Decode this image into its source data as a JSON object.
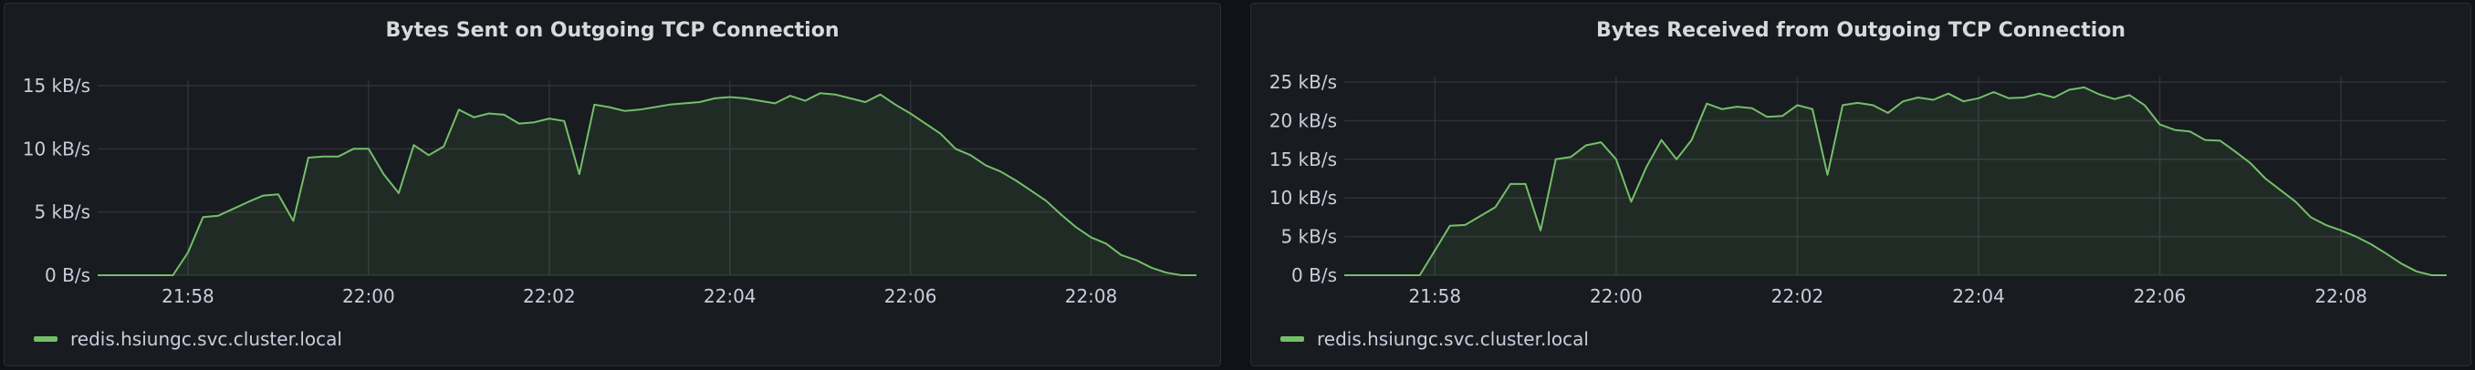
{
  "colors": {
    "series": "#73bf69",
    "grid": "#2f3237",
    "text": "#ccccdc"
  },
  "panels": [
    {
      "title": "Bytes Sent on Outgoing TCP Connection",
      "legend": "redis.hsiungc.svc.cluster.local"
    },
    {
      "title": "Bytes Received from Outgoing TCP Connection",
      "legend": "redis.hsiungc.svc.cluster.local"
    }
  ],
  "chart_data": [
    {
      "type": "area",
      "title": "Bytes Sent on Outgoing TCP Connection",
      "unit": "kB/s",
      "ylim": [
        0,
        15
      ],
      "yticks": [
        0,
        5,
        10,
        15
      ],
      "ytick_labels": [
        "0 B/s",
        "5 kB/s",
        "10 kB/s",
        "15 kB/s"
      ],
      "xlim": [
        "21:57:00",
        "21:09:10"
      ],
      "xticks": [
        "21:58",
        "22:00",
        "22:02",
        "22:04",
        "22:06",
        "22:08"
      ],
      "grid": true,
      "legend_position": "bottom-left",
      "series": [
        {
          "name": "redis.hsiungc.svc.cluster.local",
          "x": [
            "21:57:00",
            "21:57:50",
            "21:58:00",
            "21:58:10",
            "21:58:20",
            "21:58:40",
            "21:58:50",
            "21:59:00",
            "21:59:10",
            "21:59:20",
            "21:59:30",
            "21:59:40",
            "21:59:50",
            "22:00:00",
            "22:00:10",
            "22:00:20",
            "22:00:30",
            "22:00:40",
            "22:00:50",
            "22:01:00",
            "22:01:10",
            "22:01:20",
            "22:01:30",
            "22:01:40",
            "22:01:50",
            "22:02:00",
            "22:02:10",
            "22:02:20",
            "22:02:30",
            "22:02:40",
            "22:02:50",
            "22:03:00",
            "22:03:10",
            "22:03:20",
            "22:03:30",
            "22:03:40",
            "22:03:50",
            "22:04:00",
            "22:04:10",
            "22:04:20",
            "22:04:30",
            "22:04:40",
            "22:04:50",
            "22:05:00",
            "22:05:10",
            "22:05:20",
            "22:05:30",
            "22:05:40",
            "22:05:50",
            "22:06:00",
            "22:06:10",
            "22:06:20",
            "22:06:30",
            "22:06:40",
            "22:06:50",
            "22:07:00",
            "22:07:10",
            "22:07:20",
            "22:07:30",
            "22:07:40",
            "22:07:50",
            "22:08:00",
            "22:08:10",
            "22:08:20",
            "22:08:30",
            "22:08:40",
            "22:08:50",
            "22:09:00",
            "22:09:10"
          ],
          "values": [
            0,
            0,
            1.8,
            4.6,
            4.7,
            5.8,
            6.3,
            6.4,
            4.3,
            9.3,
            9.4,
            9.4,
            10.0,
            10.0,
            8.0,
            6.5,
            10.3,
            9.5,
            10.2,
            13.1,
            12.5,
            12.8,
            12.7,
            12.0,
            12.1,
            12.4,
            12.2,
            8.0,
            13.5,
            13.3,
            13.0,
            13.1,
            13.3,
            13.5,
            13.6,
            13.7,
            14.0,
            14.1,
            14.0,
            13.8,
            13.6,
            14.2,
            13.8,
            14.4,
            14.3,
            14.0,
            13.7,
            14.3,
            13.5,
            12.8,
            12.0,
            11.2,
            10.0,
            9.5,
            8.7,
            8.2,
            7.5,
            6.7,
            5.9,
            4.8,
            3.8,
            3.0,
            2.5,
            1.6,
            1.2,
            0.6,
            0.2,
            0,
            0
          ]
        }
      ]
    },
    {
      "type": "area",
      "title": "Bytes Received from Outgoing TCP Connection",
      "unit": "kB/s",
      "ylim": [
        0,
        25
      ],
      "yticks": [
        0,
        5,
        10,
        15,
        20,
        25
      ],
      "ytick_labels": [
        "0 B/s",
        "5 kB/s",
        "10 kB/s",
        "15 kB/s",
        "20 kB/s",
        "25 kB/s"
      ],
      "xlim": [
        "21:57:00",
        "22:09:10"
      ],
      "xticks": [
        "21:58",
        "22:00",
        "22:02",
        "22:04",
        "22:06",
        "22:08"
      ],
      "grid": true,
      "legend_position": "bottom-left",
      "series": [
        {
          "name": "redis.hsiungc.svc.cluster.local",
          "x": [
            "21:57:00",
            "21:57:50",
            "21:58:00",
            "21:58:10",
            "21:58:20",
            "21:58:40",
            "21:58:50",
            "21:59:00",
            "21:59:10",
            "21:59:20",
            "21:59:30",
            "21:59:40",
            "21:59:50",
            "22:00:00",
            "22:00:10",
            "22:00:20",
            "22:00:30",
            "22:00:40",
            "22:00:50",
            "22:01:00",
            "22:01:10",
            "22:01:20",
            "22:01:30",
            "22:01:40",
            "22:01:50",
            "22:02:00",
            "22:02:10",
            "22:02:20",
            "22:02:30",
            "22:02:40",
            "22:02:50",
            "22:03:00",
            "22:03:10",
            "22:03:20",
            "22:03:30",
            "22:03:40",
            "22:03:50",
            "22:04:00",
            "22:04:10",
            "22:04:20",
            "22:04:30",
            "22:04:40",
            "22:04:50",
            "22:05:00",
            "22:05:10",
            "22:05:20",
            "22:05:30",
            "22:05:40",
            "22:05:50",
            "22:06:00",
            "22:06:10",
            "22:06:20",
            "22:06:30",
            "22:06:40",
            "22:06:50",
            "22:07:00",
            "22:07:10",
            "22:07:20",
            "22:07:30",
            "22:07:40",
            "22:07:50",
            "22:08:00",
            "22:08:10",
            "22:08:20",
            "22:08:30",
            "22:08:40",
            "22:08:50",
            "22:09:00",
            "22:09:10"
          ],
          "values": [
            0,
            0,
            3.2,
            6.4,
            6.5,
            8.8,
            11.8,
            11.8,
            5.8,
            15.0,
            15.3,
            16.8,
            17.2,
            15.0,
            9.5,
            14.0,
            17.5,
            15.0,
            17.5,
            22.2,
            21.5,
            21.8,
            21.6,
            20.5,
            20.6,
            22.0,
            21.5,
            13.0,
            22.0,
            22.3,
            22.0,
            21.0,
            22.5,
            23.0,
            22.7,
            23.5,
            22.5,
            22.9,
            23.7,
            22.9,
            23.0,
            23.5,
            23.0,
            24.0,
            24.3,
            23.4,
            22.8,
            23.3,
            22.0,
            19.5,
            18.8,
            18.6,
            17.5,
            17.4,
            16.0,
            14.5,
            12.5,
            11.0,
            9.5,
            7.5,
            6.5,
            5.8,
            5.0,
            4.0,
            2.8,
            1.5,
            0.5,
            0,
            0
          ]
        }
      ]
    }
  ]
}
